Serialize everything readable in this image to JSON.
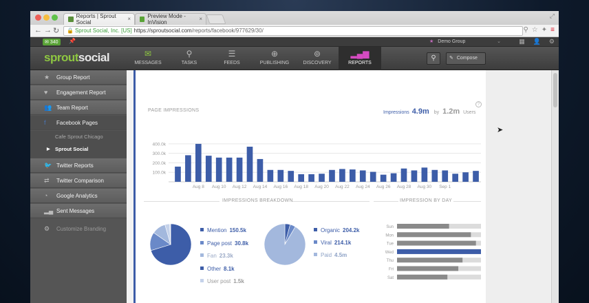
{
  "browser": {
    "tabs": [
      {
        "label": "Reports | Sprout Social",
        "close": "×"
      },
      {
        "label": "Preview Mode - InVision",
        "close": "×"
      }
    ],
    "url": {
      "cert": "Sprout Social, Inc. [US]",
      "host": "https://sproutsocial.com",
      "path": "/reports/facebook/977629/30/"
    }
  },
  "topbar": {
    "message_count": "340",
    "group": "Demo Group"
  },
  "app": {
    "logo_a": "sprout",
    "logo_b": "social",
    "nav": [
      {
        "label": "MESSAGES",
        "icon": "envelope-icon"
      },
      {
        "label": "TASKS",
        "icon": "pin-icon"
      },
      {
        "label": "FEEDS",
        "icon": "list-icon"
      },
      {
        "label": "PUBLISHING",
        "icon": "compass-icon"
      },
      {
        "label": "DISCOVERY",
        "icon": "target-icon"
      },
      {
        "label": "REPORTS",
        "icon": "bar-chart-icon"
      }
    ],
    "compose": "Compose"
  },
  "sidebar": {
    "items": [
      {
        "label": "Group Report",
        "icon": "star-icon"
      },
      {
        "label": "Engagement Report",
        "icon": "heart-icon"
      },
      {
        "label": "Team Report",
        "icon": "people-icon"
      },
      {
        "label": "Facebook Pages",
        "icon": "facebook-icon"
      },
      {
        "label": "Twitter Reports",
        "icon": "twitter-icon"
      },
      {
        "label": "Twitter Comparison",
        "icon": "compare-icon"
      },
      {
        "label": "Google Analytics",
        "icon": "analytics-icon"
      },
      {
        "label": "Sent Messages",
        "icon": "sent-icon"
      },
      {
        "label": "Customize Branding",
        "icon": "gear-icon"
      }
    ],
    "subitems": [
      "Cafe Sprout Chicago",
      "Sprout Social"
    ]
  },
  "report": {
    "page_impressions_title": "PAGE IMPRESSIONS",
    "impressions_label": "Impressions",
    "impressions_total": "4.9m",
    "by": "by",
    "users_total": "1.2m",
    "users_label": "Users",
    "breakdown_title": "IMPRESSIONS BREAKDOWN",
    "by_day_title": "IMPRESSION BY DAY",
    "breakdown_a": [
      {
        "label": "Mention",
        "value": "150.5k"
      },
      {
        "label": "Page post",
        "value": "30.8k"
      },
      {
        "label": "Fan",
        "value": "23.3k"
      },
      {
        "label": "Other",
        "value": "8.1k"
      },
      {
        "label": "User post",
        "value": "1.5k"
      }
    ],
    "breakdown_b": [
      {
        "label": "Organic",
        "value": "204.2k"
      },
      {
        "label": "Viral",
        "value": "214.1k"
      },
      {
        "label": "Paid",
        "value": "4.5m"
      }
    ]
  },
  "colors": {
    "accent": "#3d5da8",
    "mid": "#6a89c8",
    "light": "#a3b8dd",
    "lighter": "#c5d2ea",
    "gray": "#8a8a8a",
    "track": "#dcdcdc",
    "reports": "#d54bc1",
    "sprout_green": "#8ec641"
  },
  "chart_data": [
    {
      "type": "bar",
      "title": "PAGE IMPRESSIONS",
      "ylim": [
        0,
        450000
      ],
      "yticks": [
        {
          "v": 100000,
          "label": "100.0k"
        },
        {
          "v": 200000,
          "label": "200.0k"
        },
        {
          "v": 300000,
          "label": "300.0k"
        },
        {
          "v": 400000,
          "label": "400.0k"
        }
      ],
      "values": [
        160000,
        280000,
        400000,
        275000,
        255000,
        255000,
        255000,
        370000,
        240000,
        125000,
        125000,
        115000,
        80000,
        80000,
        85000,
        125000,
        135000,
        130000,
        120000,
        105000,
        75000,
        90000,
        140000,
        120000,
        150000,
        125000,
        120000,
        85000,
        100000,
        115000
      ],
      "xticks": [
        {
          "index": 2,
          "label": "Aug 8"
        },
        {
          "index": 4,
          "label": "Aug 10"
        },
        {
          "index": 6,
          "label": "Aug 12"
        },
        {
          "index": 8,
          "label": "Aug 14"
        },
        {
          "index": 10,
          "label": "Aug 16"
        },
        {
          "index": 12,
          "label": "Aug 18"
        },
        {
          "index": 14,
          "label": "Aug 20"
        },
        {
          "index": 16,
          "label": "Aug 22"
        },
        {
          "index": 18,
          "label": "Aug 24"
        },
        {
          "index": 20,
          "label": "Aug 26"
        },
        {
          "index": 22,
          "label": "Aug 28"
        },
        {
          "index": 24,
          "label": "Aug 30"
        },
        {
          "index": 26,
          "label": "Sep 1"
        }
      ],
      "grid": true
    },
    {
      "type": "pie",
      "labels": [
        "Mention",
        "Page post",
        "Fan",
        "Other",
        "User post"
      ],
      "values": [
        150.5,
        30.8,
        23.3,
        8.1,
        1.5
      ]
    },
    {
      "type": "pie",
      "labels": [
        "Organic",
        "Viral",
        "Paid"
      ],
      "values": [
        204.2,
        214.1,
        4500
      ]
    },
    {
      "type": "bar",
      "orientation": "horizontal",
      "title": "IMPRESSION BY DAY",
      "categories": [
        "Sun",
        "Mon",
        "Tue",
        "Wed",
        "Thu",
        "Fri",
        "Sat"
      ],
      "values": [
        0.62,
        0.88,
        0.94,
        1.0,
        0.78,
        0.73,
        0.6
      ]
    }
  ]
}
